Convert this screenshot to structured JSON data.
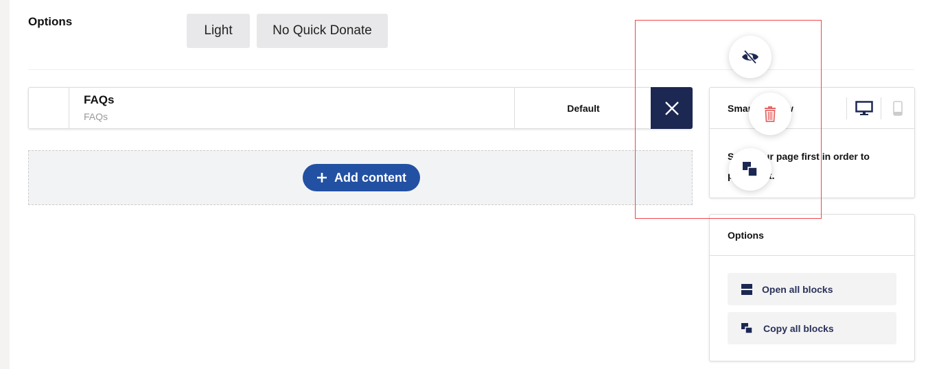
{
  "options": {
    "label": "Options",
    "chips": [
      "Light",
      "No Quick Donate"
    ]
  },
  "block": {
    "title": "FAQs",
    "subtitle": "FAQs",
    "template": "Default"
  },
  "add_content": {
    "label": "Add content"
  },
  "smart_preview": {
    "title": "Smart preview",
    "message": "Save your page first in order to preview it."
  },
  "options_card": {
    "title": "Options",
    "open_all": "Open all blocks",
    "copy_all": "Copy all blocks"
  },
  "colors": {
    "navy": "#1c2752",
    "accent": "#2251a3",
    "danger": "#e56565",
    "highlight": "#f04646"
  },
  "floating_actions": [
    "eye-slash-icon",
    "trash-icon",
    "copy-icon"
  ]
}
